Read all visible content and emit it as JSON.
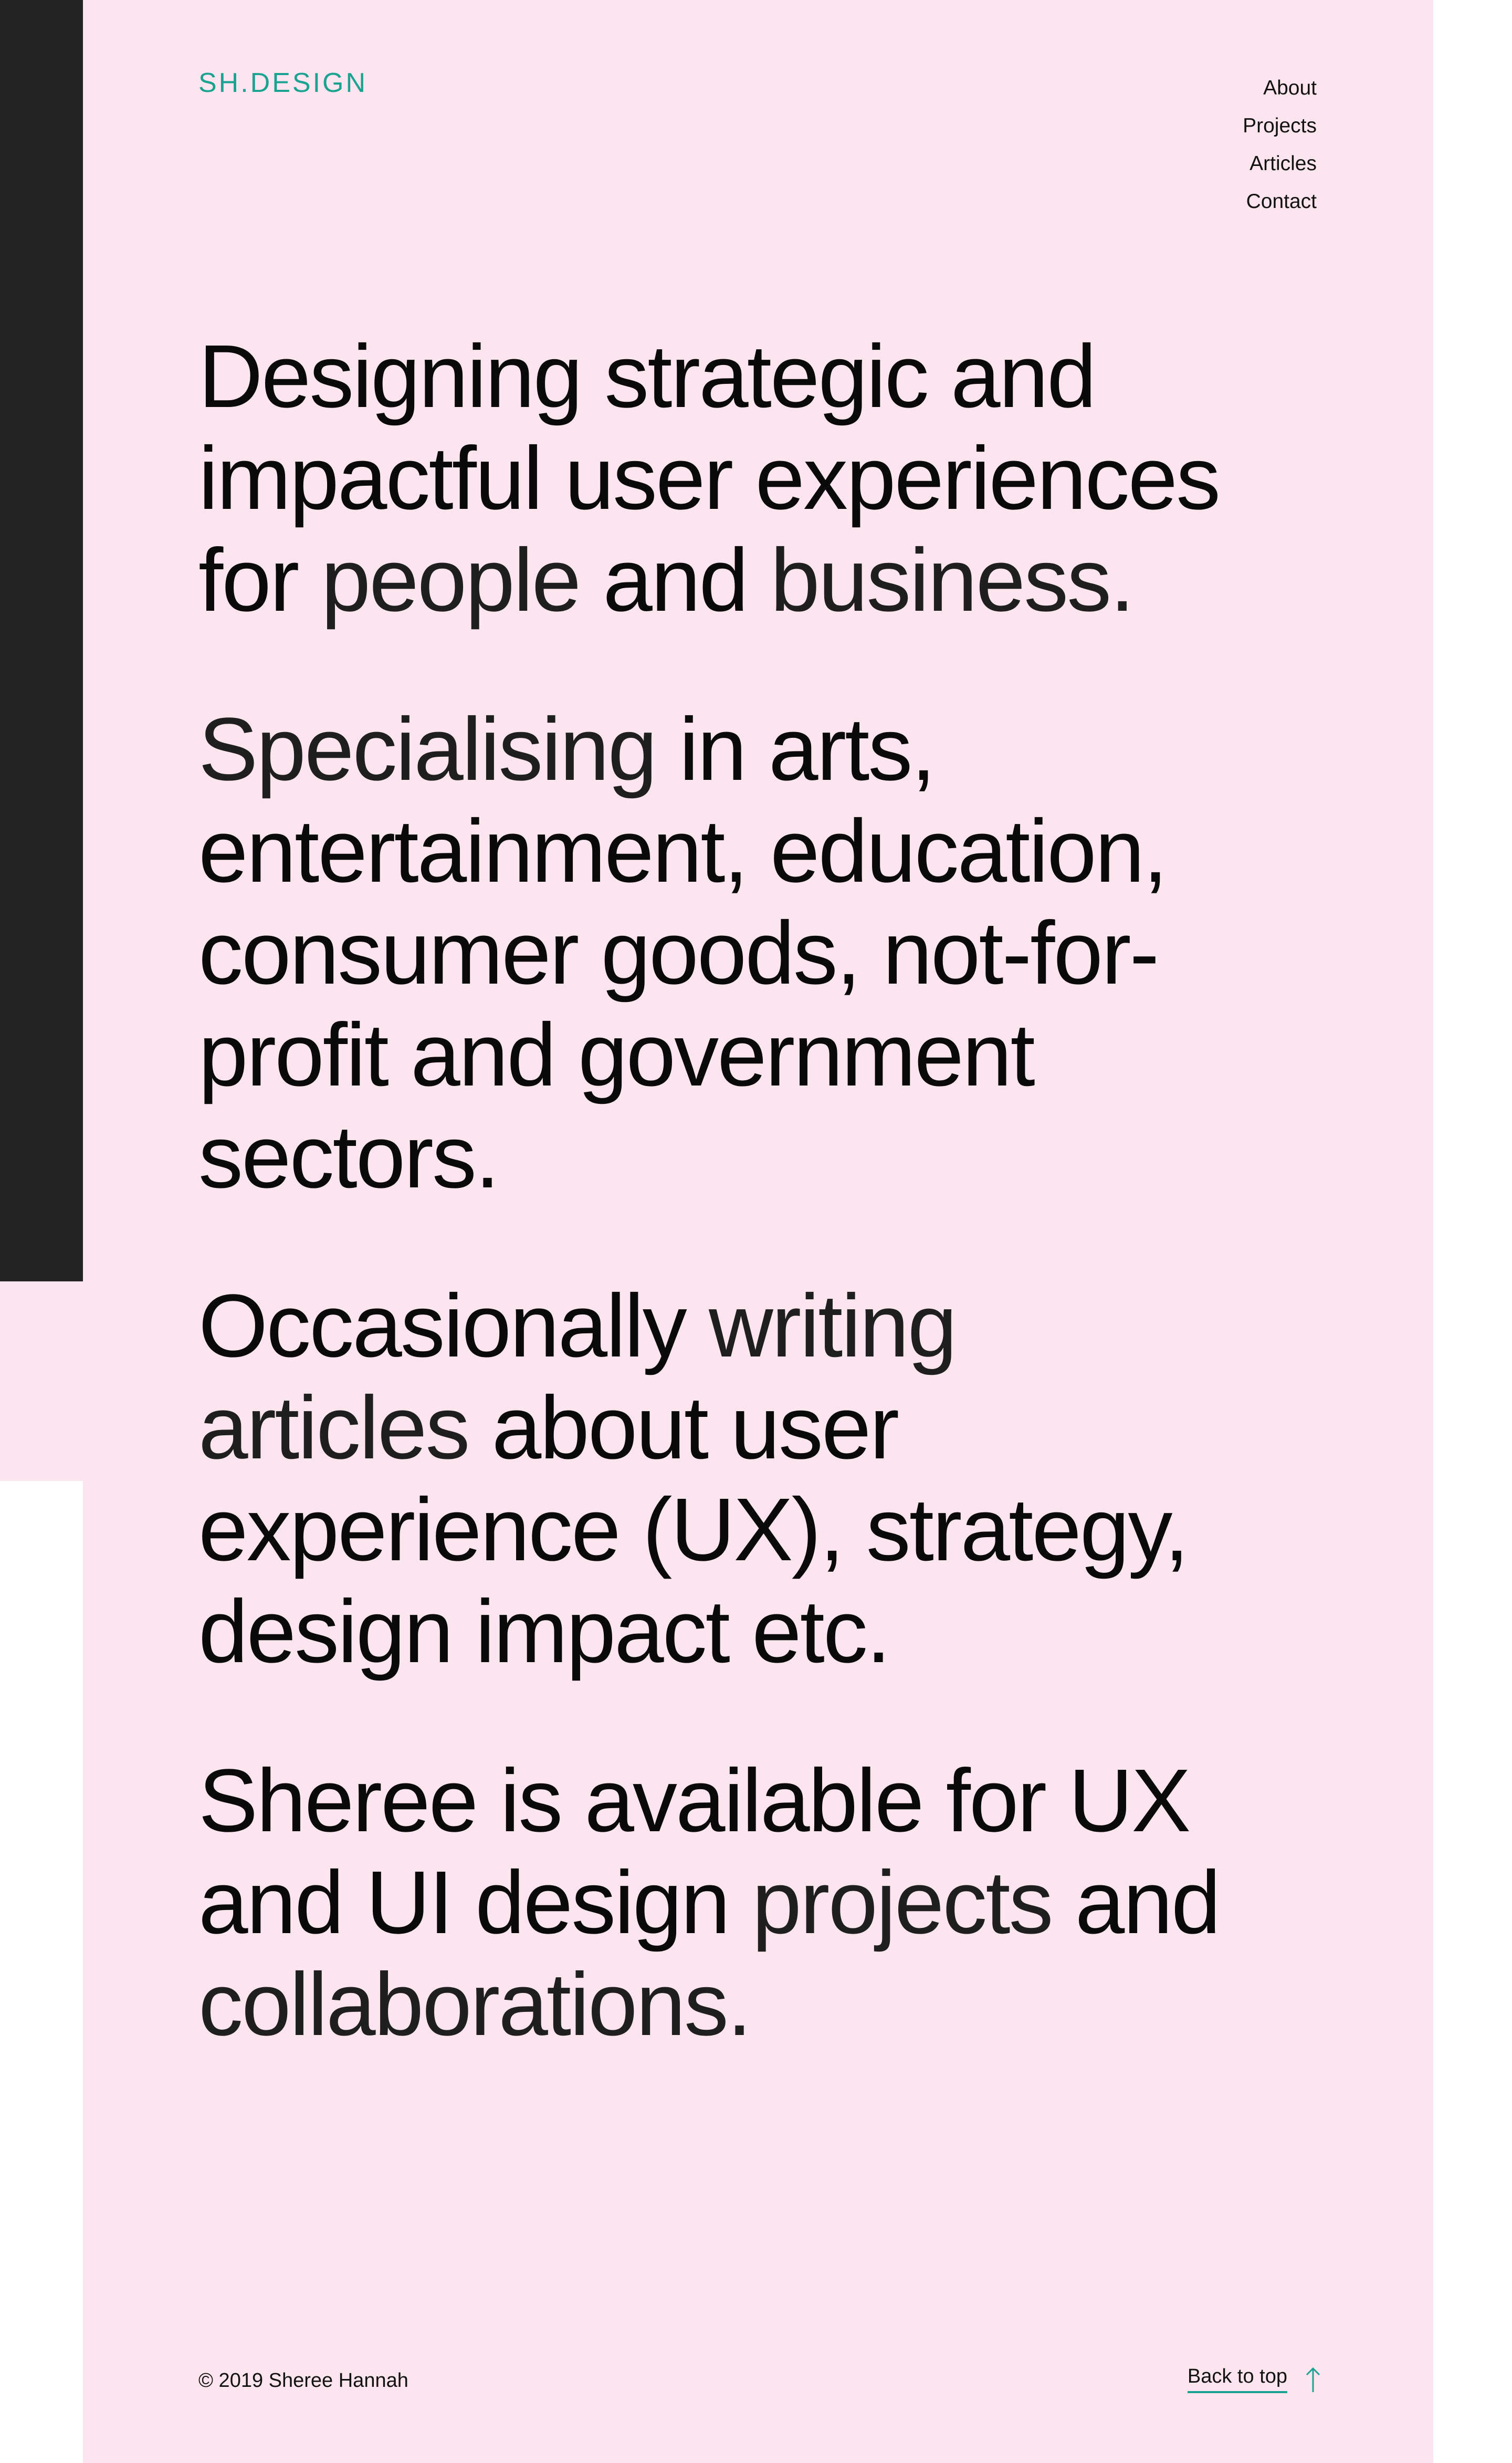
{
  "header": {
    "logo": "SH.DESIGN",
    "nav": [
      "About",
      "Projects",
      "Articles",
      "Contact"
    ]
  },
  "hero": {
    "p1": {
      "a": "Designing strategic and impactful user experiences for ",
      "b": "people",
      "c": " and ",
      "d": "business."
    },
    "p2": {
      "a": "Specialising",
      "b": " in arts, entertainment, education, consumer goods, not-for-profit and government sectors."
    },
    "p3": {
      "a": "Occasionally ",
      "b": "writing articles",
      "c": " about user experience (UX), strategy, design impact etc."
    },
    "p4": {
      "a": "Sheree is available for UX and UI design ",
      "b": "projects",
      "c": " and ",
      "d": "collaborations."
    }
  },
  "footer": {
    "copyright": "© 2019 Sheree Hannah",
    "back_to_top": "Back to top"
  },
  "icons": {
    "back_to_top": "arrow-up-icon"
  },
  "colors": {
    "page_background": "#fde5ef",
    "sidebar_dark": "#232323",
    "accent": "#1aa390"
  }
}
